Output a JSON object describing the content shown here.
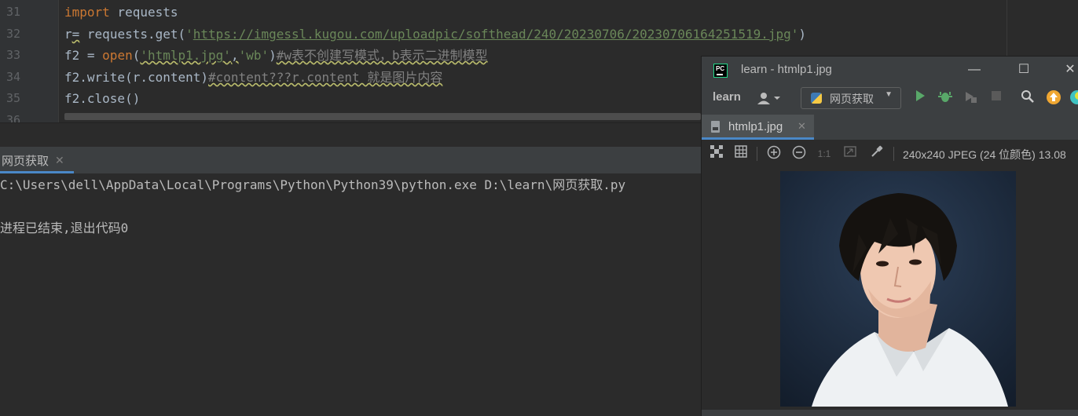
{
  "editor": {
    "line_numbers": [
      "31",
      "32",
      "33",
      "34",
      "35",
      "36"
    ],
    "lines": {
      "l31": {
        "kw": "import",
        "rest": " requests"
      },
      "l32": {
        "a": "r",
        "b": "=",
        "c": " requests.get(",
        "q1": "'",
        "url": "https://imgessl.kugou.com/uploadpic/softhead/240/20230706/20230706164251519.jpg",
        "q2": "'",
        "d": ")"
      },
      "l33": {
        "a": "f2 = ",
        "kw": "open",
        "b": "(",
        "s1": "'htmlp1.jpg'",
        "comma": ",",
        "s2": "'wb'",
        "c": ")",
        "cmt": "#w表不创建写模式，b表示二进制模型"
      },
      "l34": {
        "a": "f2.write(r.content)",
        "cmt": "#content???r.content 就是图片内容"
      },
      "l35": {
        "a": "f2.close()"
      }
    }
  },
  "run": {
    "tab_label": "网页获取",
    "tab_close": "✕",
    "command": "C:\\Users\\dell\\AppData\\Local\\Programs\\Python\\Python39\\python.exe D:\\learn\\网页获取.py",
    "exit_message": "进程已结束,退出代码0"
  },
  "viewer": {
    "app_icon_text": "PC",
    "title": "learn - htmlp1.jpg",
    "window_buttons": {
      "minimize": "—",
      "maximize": "☐",
      "close": "✕"
    },
    "project_name": "learn",
    "run_config_label": "网页获取",
    "file_tab": {
      "label": "htmlp1.jpg",
      "close": "✕"
    },
    "zoom_actual_label": "1:1",
    "image_info": "240x240 JPEG (24 位颜色) 13.08"
  },
  "colors": {
    "editor_bg": "#2b2b2b",
    "keyword": "#cc7832",
    "string": "#6a8759",
    "comment": "#808080",
    "accent": "#4a88c7",
    "run_green": "#59a869",
    "upgrade_orange": "#f0a732"
  },
  "icons": {
    "user": "user-icon",
    "run": "run-icon",
    "debug": "bug-icon",
    "coverage": "coverage-icon",
    "stop": "stop-icon",
    "search": "search-icon",
    "update": "update-icon"
  }
}
